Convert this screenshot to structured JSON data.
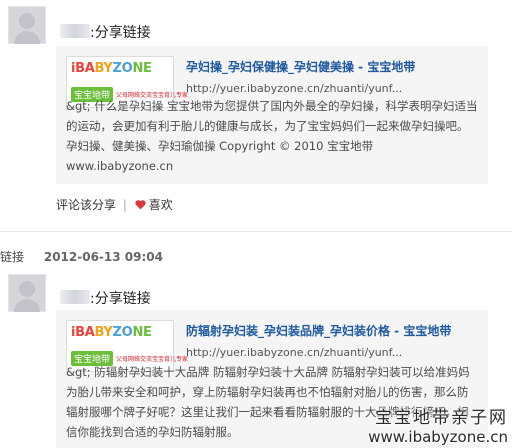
{
  "posts": [
    {
      "share_text": ":分享链接",
      "card": {
        "title": "孕妇操_孕妇保健操_孕妇健美操 - 宝宝地带",
        "url": "http://yuer.ibabyzone.cn/zhuanti/yunf...",
        "desc": "&gt; 什么是孕妇操 宝宝地带为您提供了国内外最全的孕妇操，科学表明孕妇适当的运动，会更加有利于胎儿的健康与成长，为了宝宝妈妈们一起来做孕妇操吧。 孕妇操、健美操、孕妇瑜伽操 Copyright © 2010 宝宝地带 www.ibabyzone.cn"
      },
      "actions": {
        "comment": "评论",
        "share": "该分享",
        "like": "喜欢"
      }
    },
    {
      "header": {
        "type": "链接",
        "time": "2012-06-13 09:04"
      },
      "share_text": ":分享链接",
      "card": {
        "title": "防辐射孕妇装_孕妇装品牌_孕妇装价格 - 宝宝地带",
        "url": "http://yuer.ibabyzone.cn/zhuanti/yunf...",
        "desc": "&gt; 防辐射孕妇装十大品牌 防辐射孕妇装十大品牌 防辐射孕妇装可以给准妈妈为胎儿带来安全和呵护，穿上防辐射孕妇装再也不怕辐射对胎儿的伤害，那么防辐射服哪个牌子好呢？这里让我们一起来看看防辐射服的十大品牌排行榜吧，相信你能找到合适的孕妇防辐射服。"
      }
    }
  ],
  "logo": {
    "letters": [
      "iBA",
      "BY",
      "ZO",
      "NE"
    ],
    "cn": "宝宝地带",
    "tagline": "父母网络交流宝宝育儿专家"
  },
  "watermark": {
    "cn": "宝宝地带亲子网",
    "en": "www.ibabyzone.cn"
  },
  "colors": {
    "link": "#1f5aa0",
    "card_bg": "#f5f5f5",
    "like_heart": "#d83a3a"
  }
}
